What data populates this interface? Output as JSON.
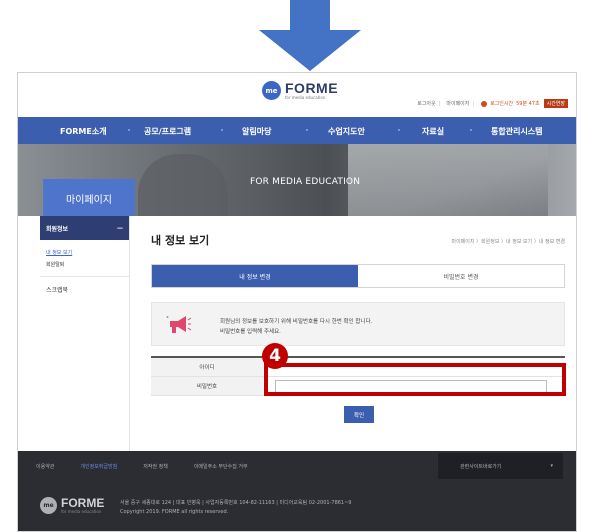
{
  "header": {
    "logo_mark": "me",
    "logo_name": "FORME",
    "logo_sub": "for media education",
    "util": {
      "logout": "로그아웃",
      "mypage": "마이페이지",
      "timer_label": "로그인시간",
      "timer_value": "59분 47초",
      "extend": "시간연장"
    }
  },
  "nav": {
    "items": [
      "FORME소개",
      "공모/프로그램",
      "알림마당",
      "수업지도안",
      "자료실",
      "통합관리시스템"
    ]
  },
  "banner": {
    "text": "FOR MEDIA EDUCATION",
    "section_title": "마이페이지"
  },
  "sidebar": {
    "head": "회원정보",
    "head_toggle": "—",
    "links": [
      "내 정보 보기",
      "회원탈퇴"
    ],
    "scrap": "스크랩북"
  },
  "main": {
    "title": "내 정보 보기",
    "breadcrumb": "마이페이지 〉회원정보 〉내 정보 보기 〉내 정보 변경",
    "tabs": [
      "내 정보 변경",
      "비밀번호 변경"
    ],
    "notice_line1": "회원님의 정보를 보호하기 위해 비밀번호를 다시 한번 확인 합니다.",
    "notice_line2": "비밀번호를 입력해 주세요.",
    "form": {
      "id_label": "아이디",
      "pw_label": "비밀번호",
      "pw_value": ""
    },
    "confirm": "확인"
  },
  "annotation": {
    "number": "4",
    "color": "#c00000"
  },
  "footer": {
    "links": [
      "이용약관",
      "개인정보취급방침",
      "저작권 정책",
      "이메일주소 무단수집 거부"
    ],
    "related": "관련사이트바로가기",
    "related_arrow": "▾",
    "logo_name": "FORME",
    "logo_sub": "for media education",
    "address": "서울 중구 세종대로 124  |  대표 민병욱  |  사업자등록번호 104-82-11163  |  미디어교육팀 02-2001-7861~9",
    "copyright": "Copyright 2019. FORME all rights reserved."
  },
  "colors": {
    "nav_bg": "#3c5eae",
    "accent_blue": "#4e74cc",
    "arrow": "#4472c4",
    "highlight": "#c00000"
  }
}
